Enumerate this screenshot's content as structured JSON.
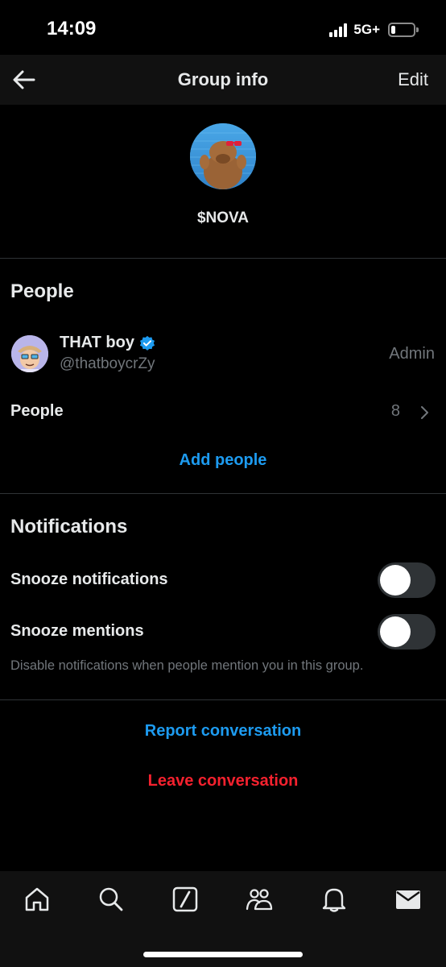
{
  "status_bar": {
    "time": "14:09",
    "network": "5G+",
    "battery_level": 0.2
  },
  "header": {
    "title": "Group info",
    "edit_label": "Edit",
    "back_icon": "arrow-left-icon"
  },
  "group": {
    "name": "$NOVA",
    "avatar_icon": "capybara-avatar"
  },
  "people_section": {
    "title": "People",
    "admin": {
      "display_name": "THAT boy",
      "handle": "@thatboycrZy",
      "role": "Admin",
      "verified": true
    },
    "people_row": {
      "label": "People",
      "count": "8"
    },
    "add_people_label": "Add people"
  },
  "notifications_section": {
    "title": "Notifications",
    "snooze_notifications": {
      "label": "Snooze notifications",
      "enabled": false
    },
    "snooze_mentions": {
      "label": "Snooze mentions",
      "enabled": false
    },
    "hint": "Disable notifications when people mention you in this group."
  },
  "actions": {
    "report_label": "Report conversation",
    "leave_label": "Leave conversation"
  },
  "bottom_nav": {
    "items": [
      "home-icon",
      "search-icon",
      "grok-icon",
      "communities-icon",
      "notifications-icon",
      "messages-icon"
    ]
  },
  "colors": {
    "accent": "#1d9bf0",
    "danger": "#f4212e",
    "muted": "#71767b",
    "background": "#000000"
  }
}
